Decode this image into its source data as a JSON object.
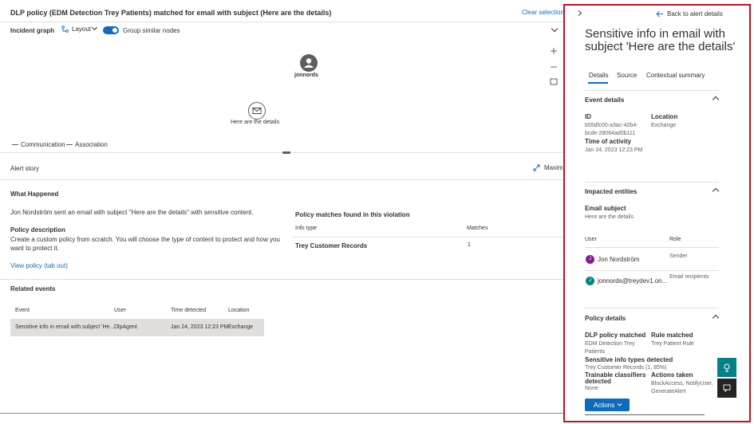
{
  "header": {
    "title": "DLP policy (EDM Detection Trey Patients) matched for email with subject (Here are the details)",
    "clear_selection": "Clear selection"
  },
  "graph_toolbar": {
    "incident_graph": "Incident graph",
    "layout": "Layout",
    "group_similar": "Group similar nodes",
    "group_similar_on": true
  },
  "graph": {
    "user_node": "jonnords",
    "mail_node": "Here are the details",
    "legend": [
      "Communication",
      "Association"
    ]
  },
  "alert_story": {
    "title": "Alert story",
    "maximize": "Maximize",
    "what_happened_title": "What Happened",
    "what_happened_text": "Jon Nordström sent an email with subject \"Here are the details\" with sensitive content.",
    "policy_description_title": "Policy description",
    "policy_description_text": "Create a custom policy from scratch. You will choose the type of content to protect and how you want to protect it.",
    "view_policy": "View policy (tab out)",
    "policy_matches_title": "Policy matches found in this violation",
    "policy_matches_headers": [
      "Info type",
      "Matches"
    ],
    "policy_matches_rows": [
      [
        "Trey Customer Records",
        "1"
      ]
    ],
    "related_events_title": "Related events",
    "related_headers": [
      "Event",
      "User",
      "Time detected",
      "Location"
    ],
    "related_rows": [
      [
        "Sensitive info in email with subject 'He...",
        "DlpAgent",
        "Jan 24, 2023 12:23 PM",
        "Exchange"
      ]
    ]
  },
  "panel": {
    "back": "Back to alert details",
    "title": "Sensitive info in email with subject 'Here are the details'",
    "tabs": [
      "Details",
      "Source",
      "Contextual summary"
    ],
    "active_tab": "Details",
    "event_details": {
      "title": "Event details",
      "id_label": "ID",
      "id_value_1": "b55dfc00-a3ac-42b4-",
      "id_value_2": "bcde-28064ad0b111",
      "location_label": "Location",
      "location_value": "Exchange",
      "time_label": "Time of activity",
      "time_value": "Jan 24, 2023 12:23 PM"
    },
    "impacted": {
      "title": "Impacted entities",
      "email_subject_label": "Email subject",
      "email_subject_value": "Here are the details",
      "user_header": "User",
      "role_header": "Role",
      "users": [
        {
          "initial": "J",
          "name": "Jon Nordström",
          "role": "Sender",
          "color": "#881798"
        },
        {
          "initial": "J",
          "name": "jonnords@treydev1.on...",
          "role": "Email recipients",
          "color": "#038387"
        }
      ]
    },
    "policy": {
      "title": "Policy details",
      "dlp_label": "DLP policy matched",
      "dlp_value_1": "EDM Detection Trey",
      "dlp_value_2": "Patients",
      "rule_label": "Rule matched",
      "rule_value": "Trey Patient Rule",
      "sit_label": "Sensitive info types detected",
      "sit_value": "Trey Customer Records (1, 85%)",
      "classifiers_label_1": "Trainable classifiers",
      "classifiers_label_2": "detected",
      "classifiers_value": "None",
      "actions_label": "Actions taken",
      "actions_value_1": "BlockAccess, NotifyUser,",
      "actions_value_2": "GenerateAlert"
    },
    "actions_button": "Actions",
    "colors": {
      "accent": "#0f6cbd",
      "highlight_border": "#c50f1f",
      "fab_teal": "#038387",
      "fab_dark": "#252423"
    }
  }
}
